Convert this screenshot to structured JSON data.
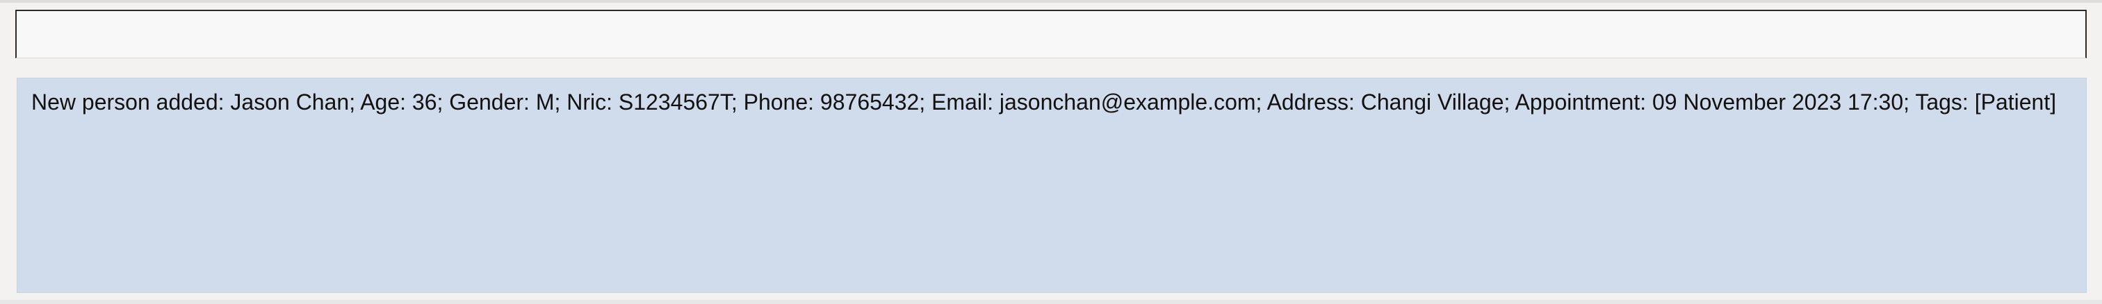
{
  "command_box": {
    "value": "",
    "placeholder": ""
  },
  "result_display": {
    "text": "New person added: Jason Chan; Age: 36; Gender: M; Nric: S1234567T; Phone: 98765432; Email: jasonchan@example.com; Address: Changi Village; Appointment: 09 November 2023 17:30; Tags: [Patient]"
  },
  "colors": {
    "result_background": "#d0dceb",
    "command_box_background": "#f8f8f8",
    "window_background": "#f3f2f1"
  }
}
